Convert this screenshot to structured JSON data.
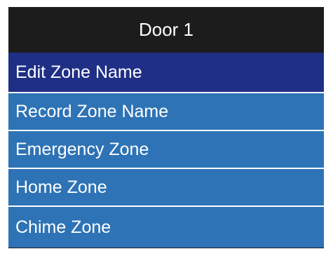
{
  "header": {
    "title": "Door 1"
  },
  "menu": {
    "items": [
      {
        "label": "Edit Zone Name",
        "selected": true
      },
      {
        "label": "Record Zone Name",
        "selected": false
      },
      {
        "label": "Emergency Zone",
        "selected": false
      },
      {
        "label": "Home Zone",
        "selected": false
      },
      {
        "label": "Chime Zone",
        "selected": false
      }
    ]
  },
  "colors": {
    "title_bar": "#1c1c1c",
    "selected_item": "#1f2f86",
    "item": "#2e73b5",
    "text": "#ffffff"
  }
}
